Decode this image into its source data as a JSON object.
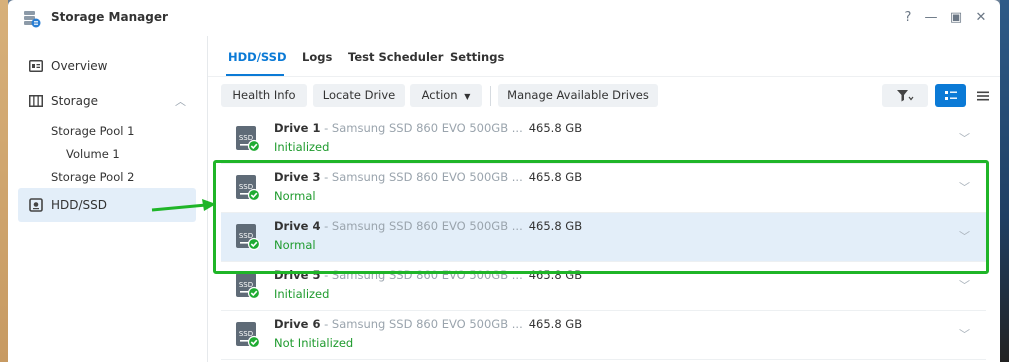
{
  "window": {
    "title": "Storage Manager"
  },
  "window_controls": {
    "help": "?",
    "minimize": "—",
    "maximize": "▣",
    "close": "✕"
  },
  "sidebar": {
    "items": [
      {
        "label": "Overview"
      },
      {
        "label": "Storage"
      },
      {
        "label": "HDD/SSD"
      }
    ],
    "sub_items": [
      {
        "label": "Storage Pool 1"
      },
      {
        "label": "Volume 1"
      },
      {
        "label": "Storage Pool 2"
      }
    ]
  },
  "tabs": [
    {
      "label": "HDD/SSD"
    },
    {
      "label": "Logs"
    },
    {
      "label": "Test Scheduler"
    },
    {
      "label": "Settings"
    }
  ],
  "toolbar": {
    "health_info": "Health Info",
    "locate_drive": "Locate Drive",
    "action": "Action",
    "manage_drives": "Manage Available Drives"
  },
  "drive_icon_text": "SSD",
  "drives": [
    {
      "name": "Drive 1",
      "model": " - Samsung SSD 860 EVO 500GB ...",
      "size": "465.8 GB",
      "status": "Initialized"
    },
    {
      "name": "Drive 3",
      "model": " - Samsung SSD 860 EVO 500GB ...",
      "size": "465.8 GB",
      "status": "Normal"
    },
    {
      "name": "Drive 4",
      "model": " - Samsung SSD 860 EVO 500GB ...",
      "size": "465.8 GB",
      "status": "Normal"
    },
    {
      "name": "Drive 5",
      "model": " - Samsung SSD 860 EVO 500GB ...",
      "size": "465.8 GB",
      "status": "Initialized"
    },
    {
      "name": "Drive 6",
      "model": " - Samsung SSD 860 EVO 500GB ...",
      "size": "465.8 GB",
      "status": "Not Initialized"
    }
  ],
  "colors": {
    "accent": "#0b7ad6",
    "status_green": "#1f9b2e",
    "highlight": "#1fb528",
    "selected_row": "#e3eef9"
  }
}
